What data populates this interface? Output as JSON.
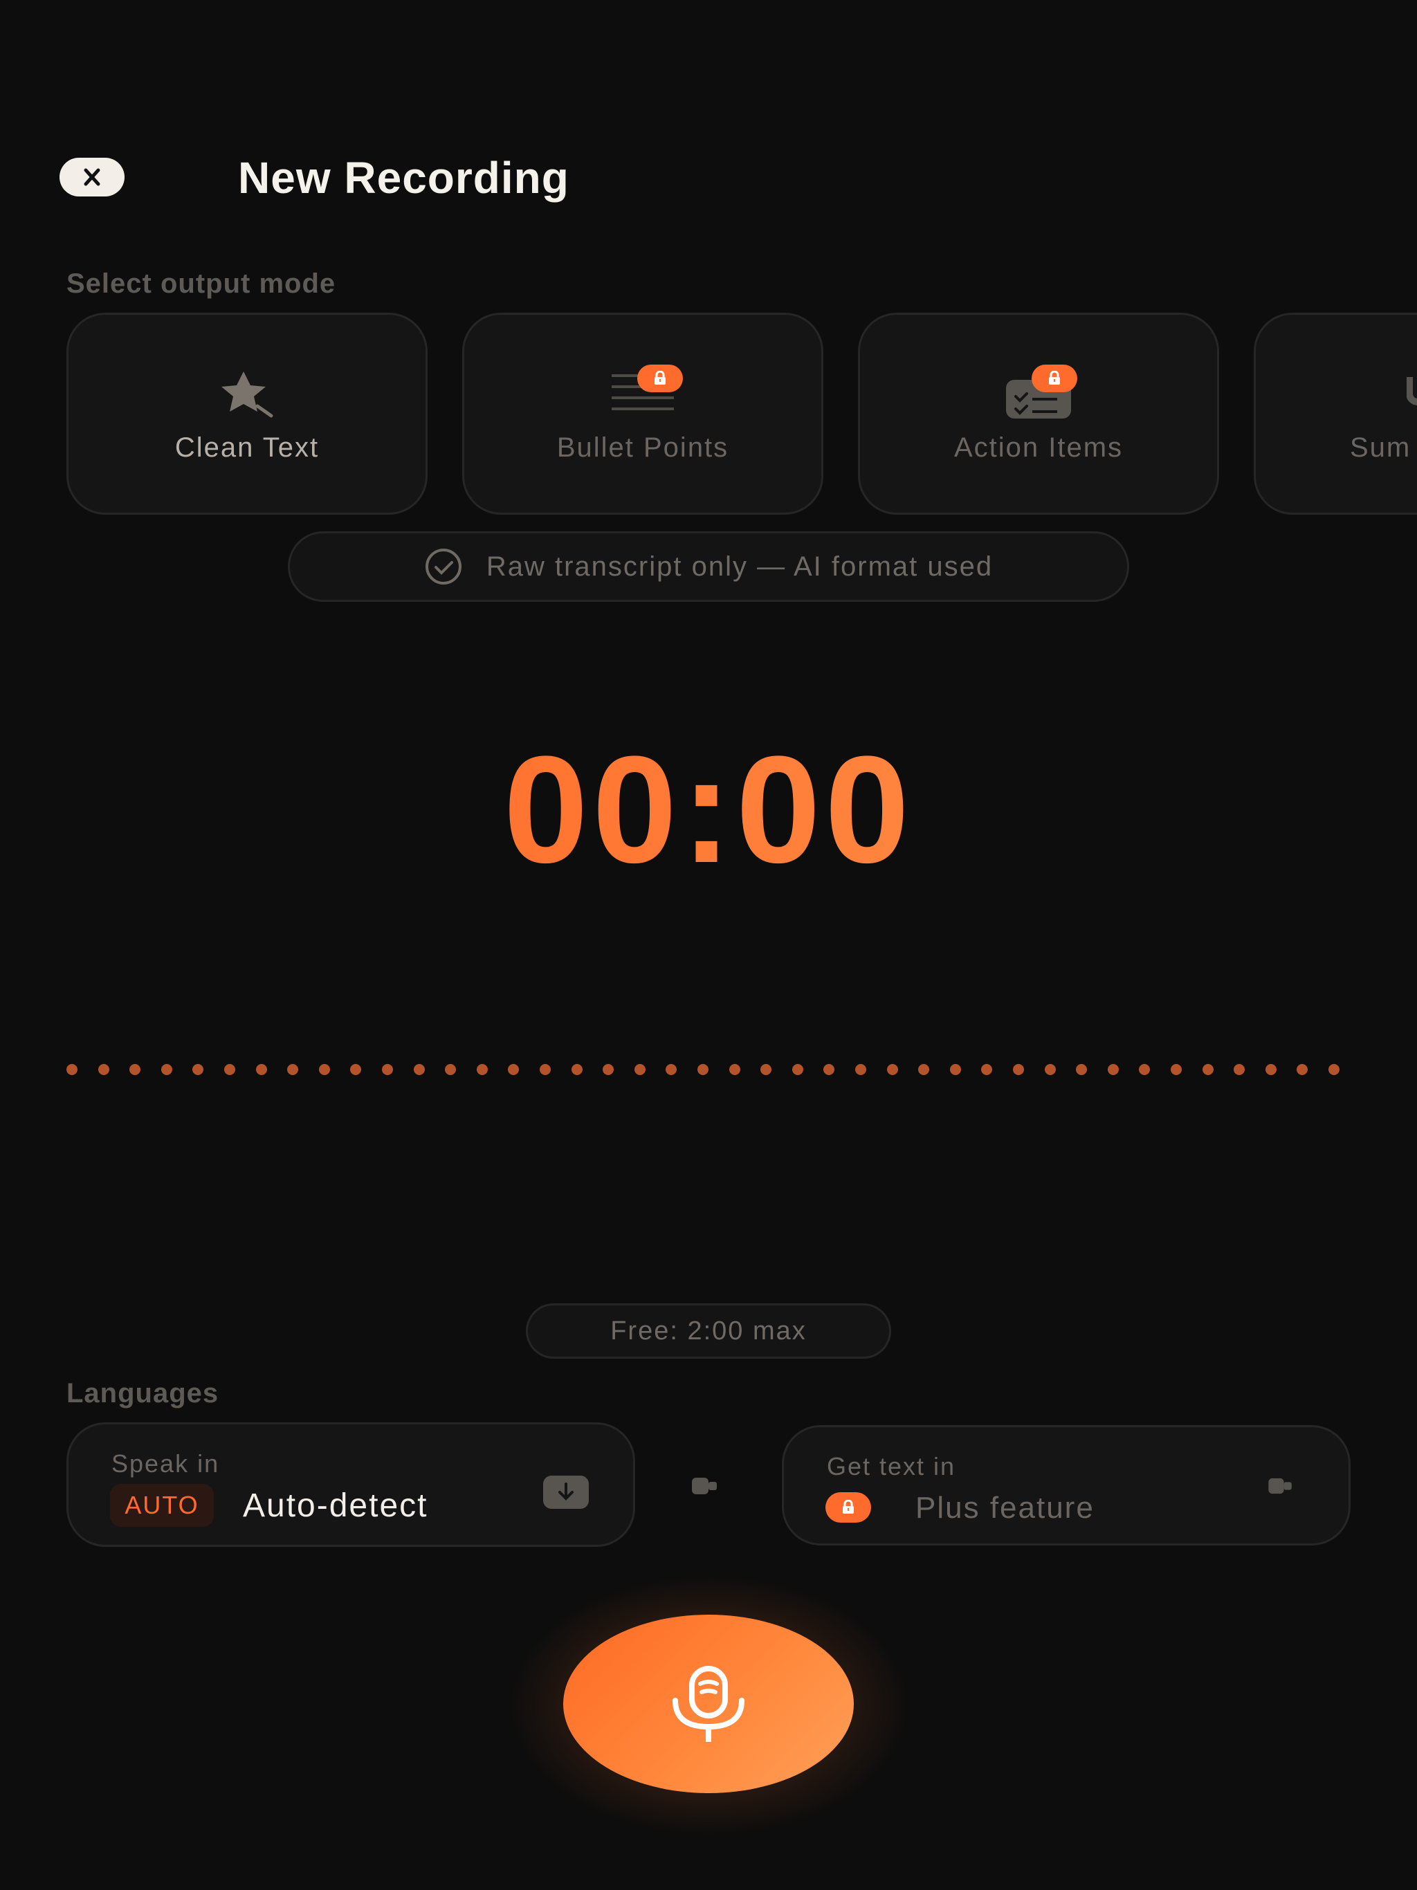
{
  "header": {
    "title": "New Recording"
  },
  "output_mode": {
    "section_label": "Select output mode",
    "modes": [
      {
        "label": "Clean Text",
        "icon": "sparkle-star-icon",
        "locked": false
      },
      {
        "label": "Bullet Points",
        "icon": "bullet-list-icon",
        "locked": true
      },
      {
        "label": "Action Items",
        "icon": "checklist-icon",
        "locked": true
      },
      {
        "label": "Sum",
        "icon": "summary-icon",
        "locked": false
      }
    ],
    "status_pill": "Raw transcript only — AI format used"
  },
  "timer": {
    "value": "00:00"
  },
  "waveform": {
    "level": 0
  },
  "limit_pill": "Free: 2:00 max",
  "languages": {
    "section_label": "Languages",
    "speak_in": {
      "label": "Speak in",
      "badge": "AUTO",
      "value": "Auto-detect"
    },
    "get_text_in": {
      "label": "Get text in",
      "value": "Plus feature",
      "locked": true
    }
  },
  "colors": {
    "accent": "#ff6b2c",
    "background": "#0d0d0d",
    "card": "#151515"
  }
}
